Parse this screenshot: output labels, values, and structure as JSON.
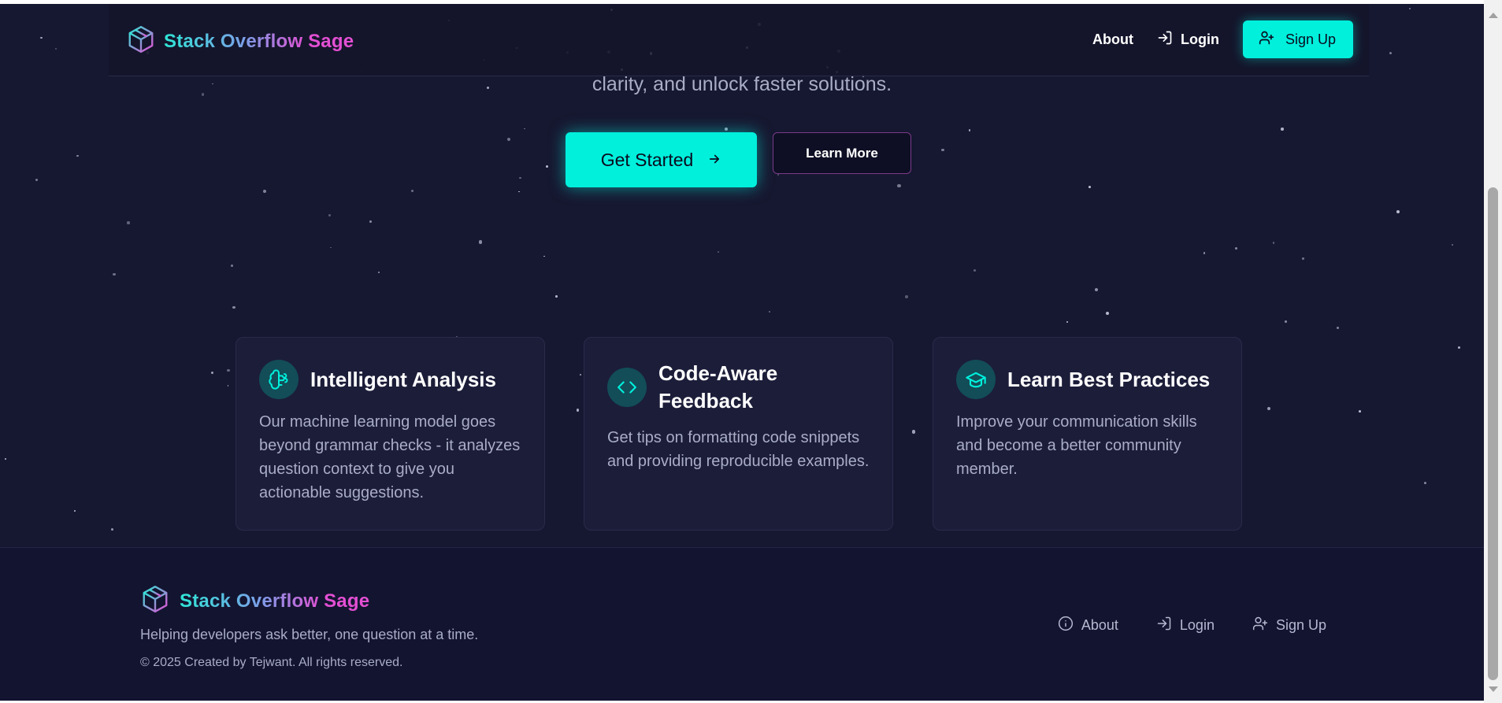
{
  "brand": {
    "name_part1": "Stack Overflow ",
    "name_part2": "Sage"
  },
  "nav": {
    "about": "About",
    "login": "Login",
    "signup": "Sign Up"
  },
  "hero": {
    "subtitle": "clarity, and unlock faster solutions.",
    "primary_cta": "Get Started",
    "secondary_cta": "Learn More"
  },
  "features": [
    {
      "icon": "brain-icon",
      "title": "Intelligent Analysis",
      "description": "Our machine learning model goes beyond grammar checks - it analyzes question context to give you actionable suggestions."
    },
    {
      "icon": "code-icon",
      "title": "Code-Aware Feedback",
      "description": "Get tips on formatting code snippets and providing reproducible examples."
    },
    {
      "icon": "graduation-cap-icon",
      "title": "Learn Best Practices",
      "description": "Improve your communication skills and become a better community member."
    }
  ],
  "footer": {
    "tagline": "Helping developers ask better, one question at a time.",
    "copyright": "© 2025 Created by Tejwant. All rights reserved.",
    "links": {
      "about": "About",
      "login": "Login",
      "signup": "Sign Up"
    }
  },
  "colors": {
    "accent": "#00f0dc",
    "background": "#161730",
    "brand_gradient_start": "#2ee6d6",
    "brand_gradient_end": "#e34fd3"
  }
}
